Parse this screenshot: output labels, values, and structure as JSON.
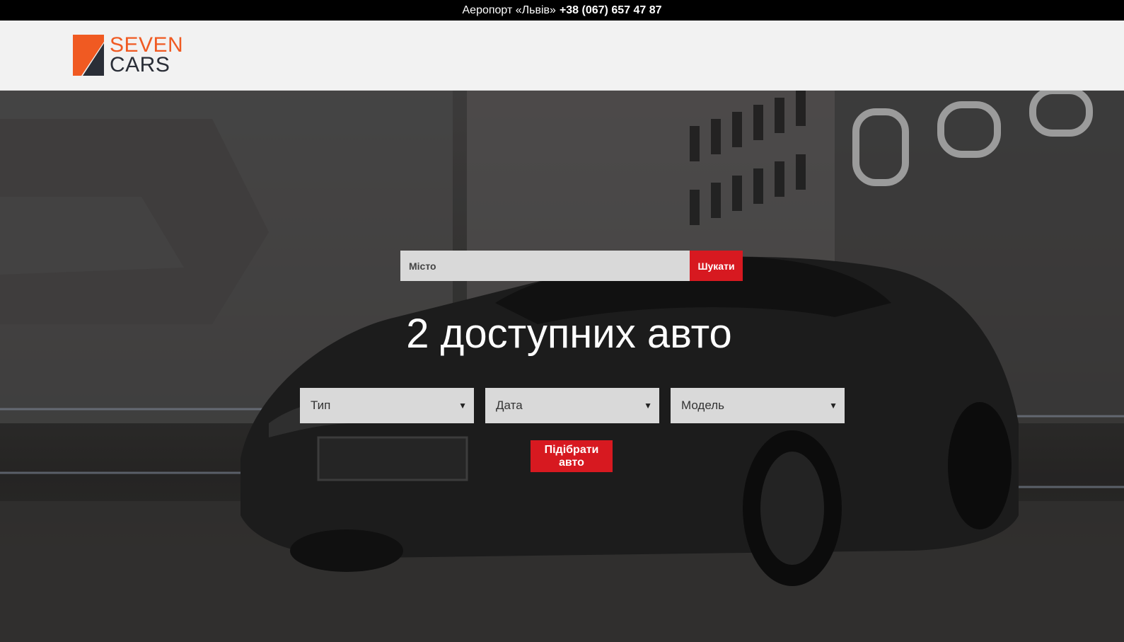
{
  "topbar": {
    "location": "Аеропорт «Львів»",
    "phone": "+38 (067) 657 47 87"
  },
  "logo": {
    "line1": "SEVEN",
    "line2": "CARS"
  },
  "search": {
    "placeholder": "Місто",
    "button_label": "Шукати"
  },
  "headline": "2 доступних авто",
  "filters": {
    "type_label": "Тип",
    "date_label": "Дата",
    "model_label": "Модель"
  },
  "pick_button": "Підібрати авто",
  "colors": {
    "accent": "#d71920",
    "logo_orange": "#f05a22",
    "logo_dark": "#2a2e37",
    "header_bg": "#f2f2f2"
  }
}
